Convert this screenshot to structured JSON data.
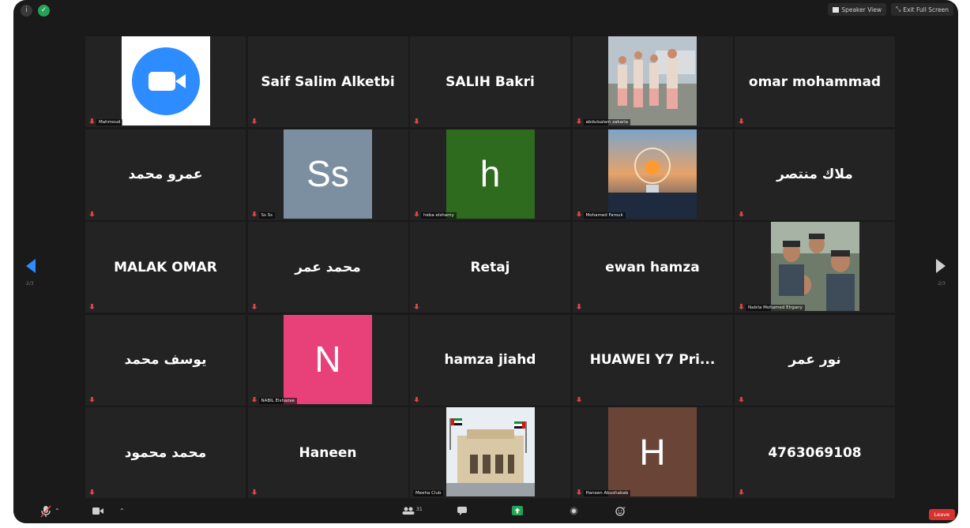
{
  "topbar": {
    "speaker_view": "Speaker View",
    "exit_full_screen": "Exit Full Screen"
  },
  "navigation": {
    "page_left": "2/3",
    "page_right": "2/3"
  },
  "tiles": [
    {
      "name": "",
      "label": "Mahmoud",
      "type": "zoom-logo"
    },
    {
      "name": "Saif Salim Alketbi",
      "label": ""
    },
    {
      "name": "SALIH Bakri",
      "label": ""
    },
    {
      "name": "",
      "label": "abdulsalam zakaria",
      "type": "photo-group"
    },
    {
      "name": "omar mohammad",
      "label": ""
    },
    {
      "name": "عمرو محمد",
      "label": ""
    },
    {
      "name": "",
      "label": "Ss Ss",
      "type": "letter",
      "letter": "Ss",
      "color": "#7b8fa1"
    },
    {
      "name": "",
      "label": "heba elshamy",
      "type": "letter",
      "letter": "h",
      "color": "#2e6b1f"
    },
    {
      "name": "",
      "label": "Mohamed Farouk",
      "type": "photo-sunset"
    },
    {
      "name": "ملاك منتصر",
      "label": ""
    },
    {
      "name": "MALAK OMAR",
      "label": ""
    },
    {
      "name": "محمد عمر",
      "label": ""
    },
    {
      "name": "Retaj",
      "label": ""
    },
    {
      "name": "ewan hamza",
      "label": ""
    },
    {
      "name": "",
      "label": "Nabila Mohamed Elrgany",
      "type": "photo-selfie"
    },
    {
      "name": "يوسف محمد",
      "label": ""
    },
    {
      "name": "",
      "label": "NABIL Elshazae",
      "type": "letter",
      "letter": "N",
      "color": "#e8417a"
    },
    {
      "name": "hamza jiahd",
      "label": ""
    },
    {
      "name": "HUAWEI Y7 Pri...",
      "label": ""
    },
    {
      "name": "نور عمر",
      "label": ""
    },
    {
      "name": "محمد محمود",
      "label": ""
    },
    {
      "name": "Haneen",
      "label": ""
    },
    {
      "name": "",
      "label": "Meeha Club",
      "type": "photo-building",
      "no_mic": true
    },
    {
      "name": "",
      "label": "Haneen Abushabab",
      "type": "letter",
      "letter": "H",
      "color": "#6b4438"
    },
    {
      "name": "4763069108",
      "label": ""
    }
  ],
  "bottombar": {
    "participants_count": "31",
    "leave_label": "Leave"
  },
  "colors": {
    "accent": "#2d8cff",
    "mic_muted": "#e04646",
    "leave": "#d93030",
    "share": "#23a455"
  }
}
